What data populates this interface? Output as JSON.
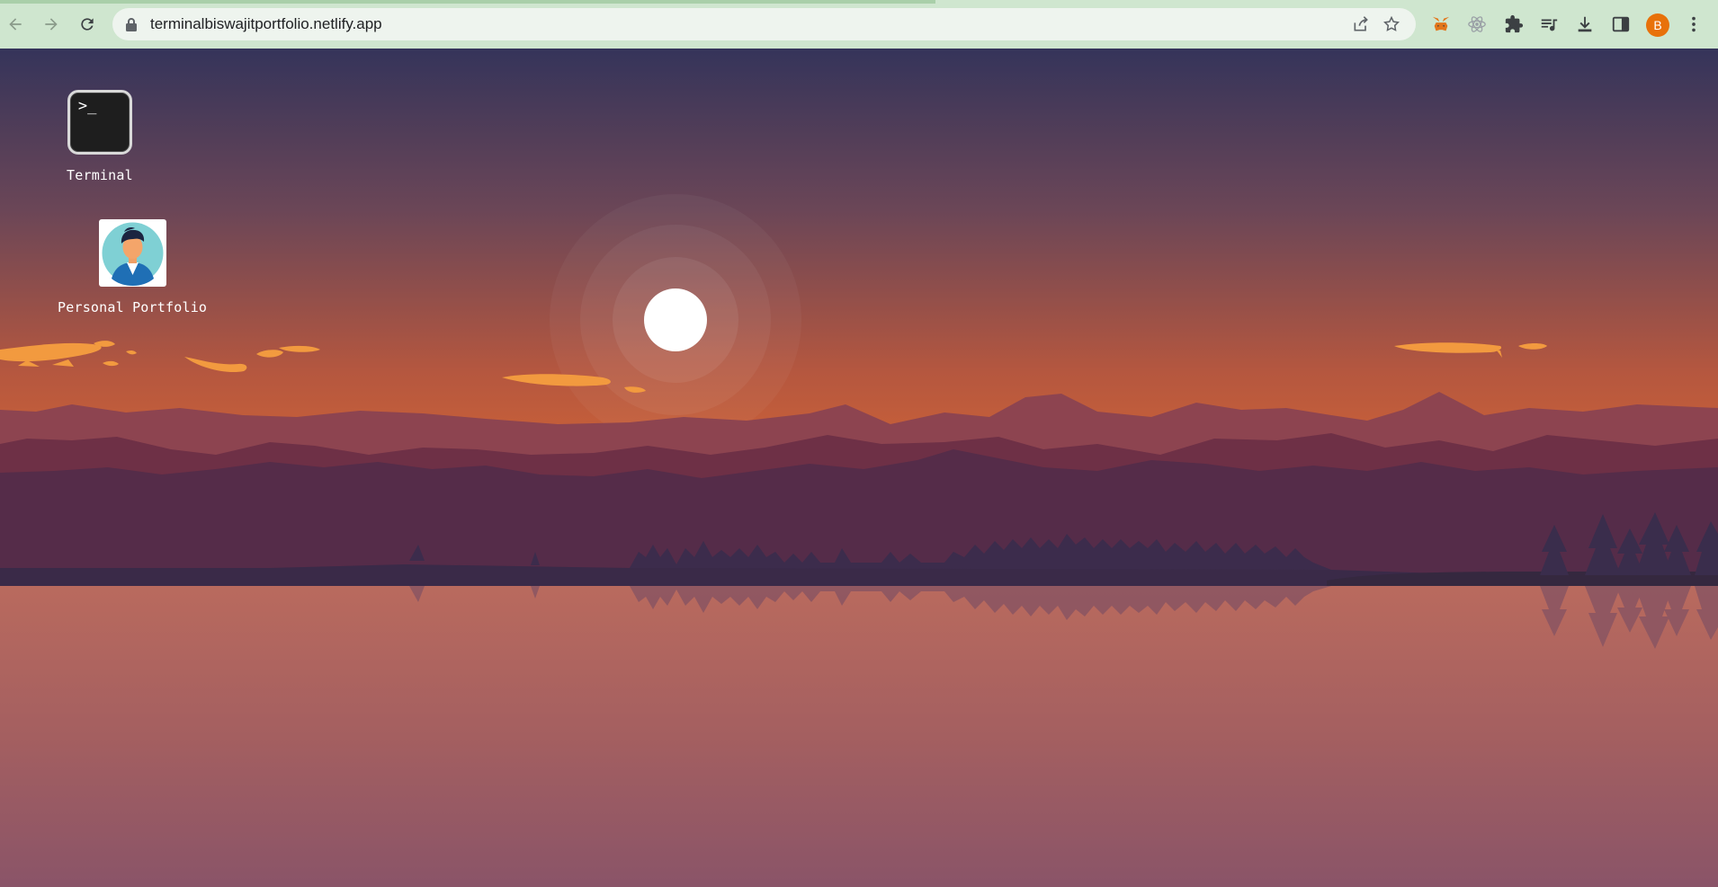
{
  "browser": {
    "url": "terminalbiswajitportfolio.netlify.app",
    "profile_initial": "B",
    "nav_icons": [
      "back-arrow-icon",
      "forward-arrow-icon",
      "reload-icon"
    ],
    "omnibox_icons": [
      "lock-icon",
      "share-icon",
      "bookmark-star-icon"
    ],
    "extension_icons": [
      "metamask-fox-icon",
      "react-devtools-icon",
      "puzzle-extensions-icon",
      "media-queue-icon",
      "download-icon",
      "side-panel-icon"
    ],
    "colors": {
      "chrome_bg": "#cfe6cf",
      "omnibox_bg": "#eef4ee",
      "profile_bg": "#e8710a"
    }
  },
  "desktop": {
    "icons": [
      {
        "label": "Terminal",
        "glyph": ">_",
        "icon": "terminal-icon"
      },
      {
        "label": "Personal Portfolio",
        "icon": "portfolio-avatar-icon"
      }
    ],
    "wallpaper": {
      "description_colors": {
        "sky_top": "#35345a",
        "sky_bottom": "#e06b30",
        "sun": "#ffffff",
        "clouds": "#f29a3f",
        "water": "#b0665f"
      }
    }
  }
}
